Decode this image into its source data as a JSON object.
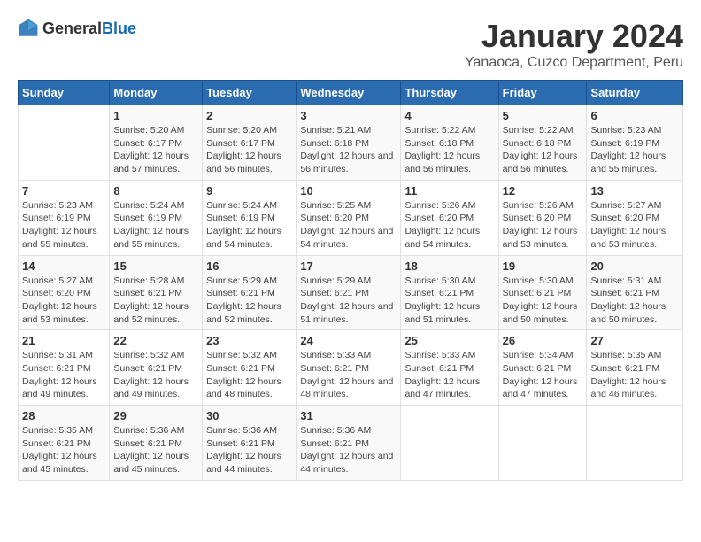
{
  "header": {
    "logo_general": "General",
    "logo_blue": "Blue",
    "month_title": "January 2024",
    "location": "Yanaoca, Cuzco Department, Peru"
  },
  "weekdays": [
    "Sunday",
    "Monday",
    "Tuesday",
    "Wednesday",
    "Thursday",
    "Friday",
    "Saturday"
  ],
  "weeks": [
    [
      {
        "day": "",
        "sunrise": "",
        "sunset": "",
        "daylight": ""
      },
      {
        "day": "1",
        "sunrise": "Sunrise: 5:20 AM",
        "sunset": "Sunset: 6:17 PM",
        "daylight": "Daylight: 12 hours and 57 minutes."
      },
      {
        "day": "2",
        "sunrise": "Sunrise: 5:20 AM",
        "sunset": "Sunset: 6:17 PM",
        "daylight": "Daylight: 12 hours and 56 minutes."
      },
      {
        "day": "3",
        "sunrise": "Sunrise: 5:21 AM",
        "sunset": "Sunset: 6:18 PM",
        "daylight": "Daylight: 12 hours and 56 minutes."
      },
      {
        "day": "4",
        "sunrise": "Sunrise: 5:22 AM",
        "sunset": "Sunset: 6:18 PM",
        "daylight": "Daylight: 12 hours and 56 minutes."
      },
      {
        "day": "5",
        "sunrise": "Sunrise: 5:22 AM",
        "sunset": "Sunset: 6:18 PM",
        "daylight": "Daylight: 12 hours and 56 minutes."
      },
      {
        "day": "6",
        "sunrise": "Sunrise: 5:23 AM",
        "sunset": "Sunset: 6:19 PM",
        "daylight": "Daylight: 12 hours and 55 minutes."
      }
    ],
    [
      {
        "day": "7",
        "sunrise": "Sunrise: 5:23 AM",
        "sunset": "Sunset: 6:19 PM",
        "daylight": "Daylight: 12 hours and 55 minutes."
      },
      {
        "day": "8",
        "sunrise": "Sunrise: 5:24 AM",
        "sunset": "Sunset: 6:19 PM",
        "daylight": "Daylight: 12 hours and 55 minutes."
      },
      {
        "day": "9",
        "sunrise": "Sunrise: 5:24 AM",
        "sunset": "Sunset: 6:19 PM",
        "daylight": "Daylight: 12 hours and 54 minutes."
      },
      {
        "day": "10",
        "sunrise": "Sunrise: 5:25 AM",
        "sunset": "Sunset: 6:20 PM",
        "daylight": "Daylight: 12 hours and 54 minutes."
      },
      {
        "day": "11",
        "sunrise": "Sunrise: 5:26 AM",
        "sunset": "Sunset: 6:20 PM",
        "daylight": "Daylight: 12 hours and 54 minutes."
      },
      {
        "day": "12",
        "sunrise": "Sunrise: 5:26 AM",
        "sunset": "Sunset: 6:20 PM",
        "daylight": "Daylight: 12 hours and 53 minutes."
      },
      {
        "day": "13",
        "sunrise": "Sunrise: 5:27 AM",
        "sunset": "Sunset: 6:20 PM",
        "daylight": "Daylight: 12 hours and 53 minutes."
      }
    ],
    [
      {
        "day": "14",
        "sunrise": "Sunrise: 5:27 AM",
        "sunset": "Sunset: 6:20 PM",
        "daylight": "Daylight: 12 hours and 53 minutes."
      },
      {
        "day": "15",
        "sunrise": "Sunrise: 5:28 AM",
        "sunset": "Sunset: 6:21 PM",
        "daylight": "Daylight: 12 hours and 52 minutes."
      },
      {
        "day": "16",
        "sunrise": "Sunrise: 5:29 AM",
        "sunset": "Sunset: 6:21 PM",
        "daylight": "Daylight: 12 hours and 52 minutes."
      },
      {
        "day": "17",
        "sunrise": "Sunrise: 5:29 AM",
        "sunset": "Sunset: 6:21 PM",
        "daylight": "Daylight: 12 hours and 51 minutes."
      },
      {
        "day": "18",
        "sunrise": "Sunrise: 5:30 AM",
        "sunset": "Sunset: 6:21 PM",
        "daylight": "Daylight: 12 hours and 51 minutes."
      },
      {
        "day": "19",
        "sunrise": "Sunrise: 5:30 AM",
        "sunset": "Sunset: 6:21 PM",
        "daylight": "Daylight: 12 hours and 50 minutes."
      },
      {
        "day": "20",
        "sunrise": "Sunrise: 5:31 AM",
        "sunset": "Sunset: 6:21 PM",
        "daylight": "Daylight: 12 hours and 50 minutes."
      }
    ],
    [
      {
        "day": "21",
        "sunrise": "Sunrise: 5:31 AM",
        "sunset": "Sunset: 6:21 PM",
        "daylight": "Daylight: 12 hours and 49 minutes."
      },
      {
        "day": "22",
        "sunrise": "Sunrise: 5:32 AM",
        "sunset": "Sunset: 6:21 PM",
        "daylight": "Daylight: 12 hours and 49 minutes."
      },
      {
        "day": "23",
        "sunrise": "Sunrise: 5:32 AM",
        "sunset": "Sunset: 6:21 PM",
        "daylight": "Daylight: 12 hours and 48 minutes."
      },
      {
        "day": "24",
        "sunrise": "Sunrise: 5:33 AM",
        "sunset": "Sunset: 6:21 PM",
        "daylight": "Daylight: 12 hours and 48 minutes."
      },
      {
        "day": "25",
        "sunrise": "Sunrise: 5:33 AM",
        "sunset": "Sunset: 6:21 PM",
        "daylight": "Daylight: 12 hours and 47 minutes."
      },
      {
        "day": "26",
        "sunrise": "Sunrise: 5:34 AM",
        "sunset": "Sunset: 6:21 PM",
        "daylight": "Daylight: 12 hours and 47 minutes."
      },
      {
        "day": "27",
        "sunrise": "Sunrise: 5:35 AM",
        "sunset": "Sunset: 6:21 PM",
        "daylight": "Daylight: 12 hours and 46 minutes."
      }
    ],
    [
      {
        "day": "28",
        "sunrise": "Sunrise: 5:35 AM",
        "sunset": "Sunset: 6:21 PM",
        "daylight": "Daylight: 12 hours and 45 minutes."
      },
      {
        "day": "29",
        "sunrise": "Sunrise: 5:36 AM",
        "sunset": "Sunset: 6:21 PM",
        "daylight": "Daylight: 12 hours and 45 minutes."
      },
      {
        "day": "30",
        "sunrise": "Sunrise: 5:36 AM",
        "sunset": "Sunset: 6:21 PM",
        "daylight": "Daylight: 12 hours and 44 minutes."
      },
      {
        "day": "31",
        "sunrise": "Sunrise: 5:36 AM",
        "sunset": "Sunset: 6:21 PM",
        "daylight": "Daylight: 12 hours and 44 minutes."
      },
      {
        "day": "",
        "sunrise": "",
        "sunset": "",
        "daylight": ""
      },
      {
        "day": "",
        "sunrise": "",
        "sunset": "",
        "daylight": ""
      },
      {
        "day": "",
        "sunrise": "",
        "sunset": "",
        "daylight": ""
      }
    ]
  ]
}
